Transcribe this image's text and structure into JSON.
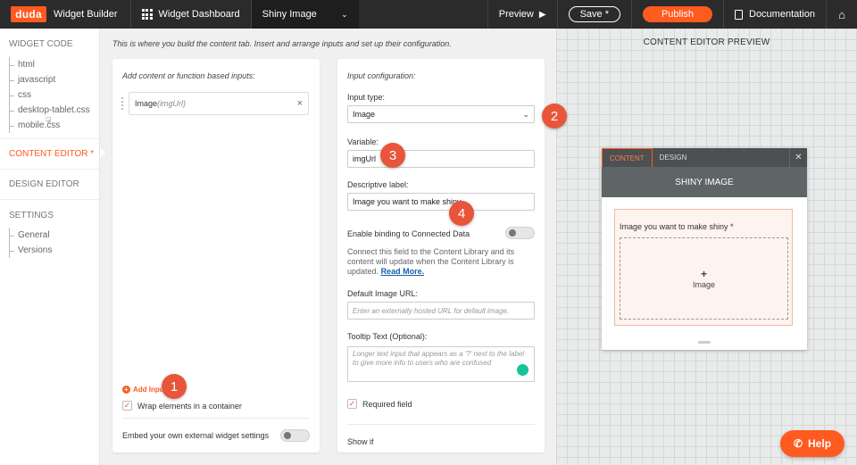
{
  "topbar": {
    "logo": "duda",
    "app_title": "Widget Builder",
    "dashboard_label": "Widget Dashboard",
    "widget_name": "Shiny Image",
    "preview_label": "Preview",
    "save_label": "Save *",
    "publish_label": "Publish",
    "documentation_label": "Documentation"
  },
  "sidebar": {
    "widget_code": "WIDGET CODE",
    "code_files": [
      "html",
      "javascript",
      "css",
      "desktop-tablet.css",
      "mobile.css"
    ],
    "content_editor": "CONTENT EDITOR *",
    "design_editor": "DESIGN EDITOR",
    "settings": "SETTINGS",
    "settings_items": [
      "General",
      "Versions"
    ]
  },
  "main": {
    "description": "This is where you build the content tab. Insert and arrange inputs and set up their configuration."
  },
  "left_panel": {
    "title": "Add content or function based inputs:",
    "input_item_name": "Image",
    "input_item_var": "(imgUrl)",
    "add_input": "Add Input",
    "wrap_label": "Wrap elements in a container",
    "embed_label": "Embed your own external widget settings"
  },
  "right_panel": {
    "title": "Input configuration:",
    "input_type_label": "Input type:",
    "input_type_value": "Image",
    "variable_label": "Variable:",
    "variable_value": "imgUrl",
    "descriptive_label": "Descriptive label:",
    "descriptive_value": "Image you want to make shiny",
    "binding_label": "Enable binding to Connected Data",
    "binding_help": "Connect this field to the Content Library and its content will update when the Content Library is updated.",
    "read_more": "Read More.",
    "default_url_label": "Default Image URL:",
    "default_url_placeholder": "Enter an externally hosted URL for default image.",
    "tooltip_label": "Tooltip Text (Optional):",
    "tooltip_placeholder": "Longer text input that appears as a '?' next to the label to give more info to users who are confused",
    "required_label": "Required field",
    "show_if": "Show if"
  },
  "preview": {
    "title": "CONTENT EDITOR PREVIEW",
    "tab_content": "CONTENT",
    "tab_design": "DESIGN",
    "widget_title": "SHINY IMAGE",
    "field_label": "Image you want to make shiny *",
    "drop_label": "Image"
  },
  "help_button": "Help",
  "annotations": [
    "1",
    "2",
    "3",
    "4"
  ]
}
